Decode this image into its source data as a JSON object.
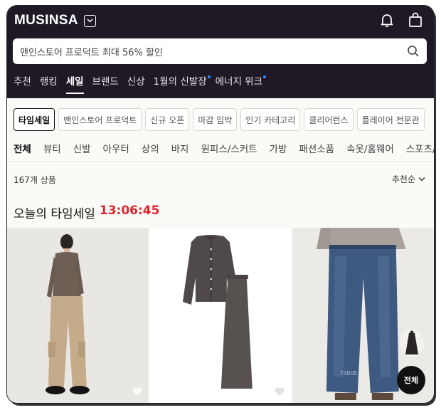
{
  "brand": {
    "logo": "MUSINSA"
  },
  "search": {
    "placeholder": "맨인스토어 프로덕트 최대 56% 할인"
  },
  "nav": {
    "items": [
      {
        "label": "추천"
      },
      {
        "label": "랭킹"
      },
      {
        "label": "세일",
        "active": true
      },
      {
        "label": "브랜드"
      },
      {
        "label": "신상"
      },
      {
        "label": "1월의 신발장",
        "dot": true
      },
      {
        "label": "에너지 위크",
        "dot": true
      }
    ]
  },
  "chips": [
    "타임세일",
    "맨인스토어 프로덕트",
    "신규 오픈",
    "마감 임박",
    "인기 카테고리",
    "클리어런스",
    "플레이어 전문관"
  ],
  "categories": [
    "전체",
    "뷰티",
    "신발",
    "아우터",
    "상의",
    "바지",
    "원피스/스커트",
    "가방",
    "패션소품",
    "속옷/홈웨어",
    "스포츠/레"
  ],
  "listing": {
    "count": "167개 상품",
    "sort": "추천순"
  },
  "timesale": {
    "title": "오늘의 타임세일",
    "timer": "13:06:45"
  },
  "products": [
    {
      "image": "woman-brown-knit-beige-cargo-pants"
    },
    {
      "image": "gray-knit-cardigan-and-skirt-set"
    },
    {
      "image": "gray-sweater-blue-wide-denim"
    }
  ],
  "floating": {
    "all_button": "전체",
    "watermark": "TODOD"
  },
  "icons": {
    "notification": "bell-icon",
    "cart": "bag-icon",
    "search": "search-icon",
    "heart": "heart-icon"
  },
  "colors": {
    "header_bg": "#1e1925",
    "accent_red": "#e0262f",
    "dot_blue": "#2b8cff"
  }
}
